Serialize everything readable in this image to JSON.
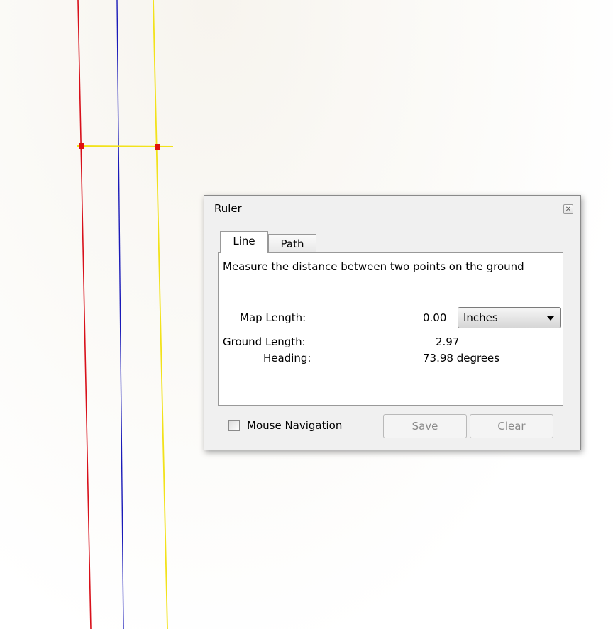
{
  "dialog": {
    "title": "Ruler",
    "close_icon": "close-icon",
    "tabs": [
      {
        "label": "Line",
        "active": true
      },
      {
        "label": "Path",
        "active": false
      }
    ],
    "description": "Measure the distance between two points on the ground",
    "map_length": {
      "label": "Map Length:",
      "value": "0.00"
    },
    "unit_select": {
      "selected": "Inches"
    },
    "ground_length": {
      "label": "Ground Length:",
      "value": "2.97"
    },
    "heading": {
      "label": "Heading:",
      "value": "73.98 degrees"
    },
    "mouse_navigation": {
      "label": "Mouse Navigation",
      "checked": false
    },
    "save_label": "Save",
    "clear_label": "Clear"
  },
  "map_colors": {
    "red_line": "#d8101a",
    "blue_line": "#1a1ab8",
    "yellow_line": "#f2e21a",
    "marker": "#e0100c"
  }
}
